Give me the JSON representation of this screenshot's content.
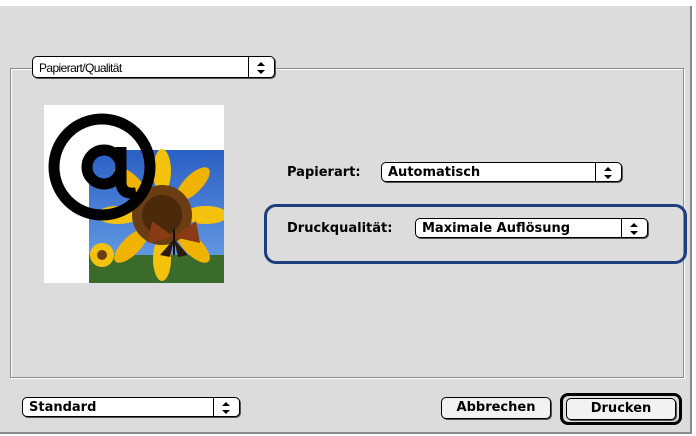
{
  "panel_selector": {
    "value": "Papierart/Qualität"
  },
  "paper_type": {
    "label": "Papierart:",
    "value": "Automatisch"
  },
  "print_quality": {
    "label": "Druckqualität:",
    "value": "Maximale Auflösung"
  },
  "preset": {
    "value": "Standard"
  },
  "buttons": {
    "cancel": "Abbrechen",
    "print": "Drucken"
  },
  "preview": {
    "icons": [
      "at-sign-icon",
      "sunflower-photo"
    ]
  },
  "colors": {
    "highlight": "#1e3f7d",
    "dialog_bg": "#dcdcdc"
  }
}
